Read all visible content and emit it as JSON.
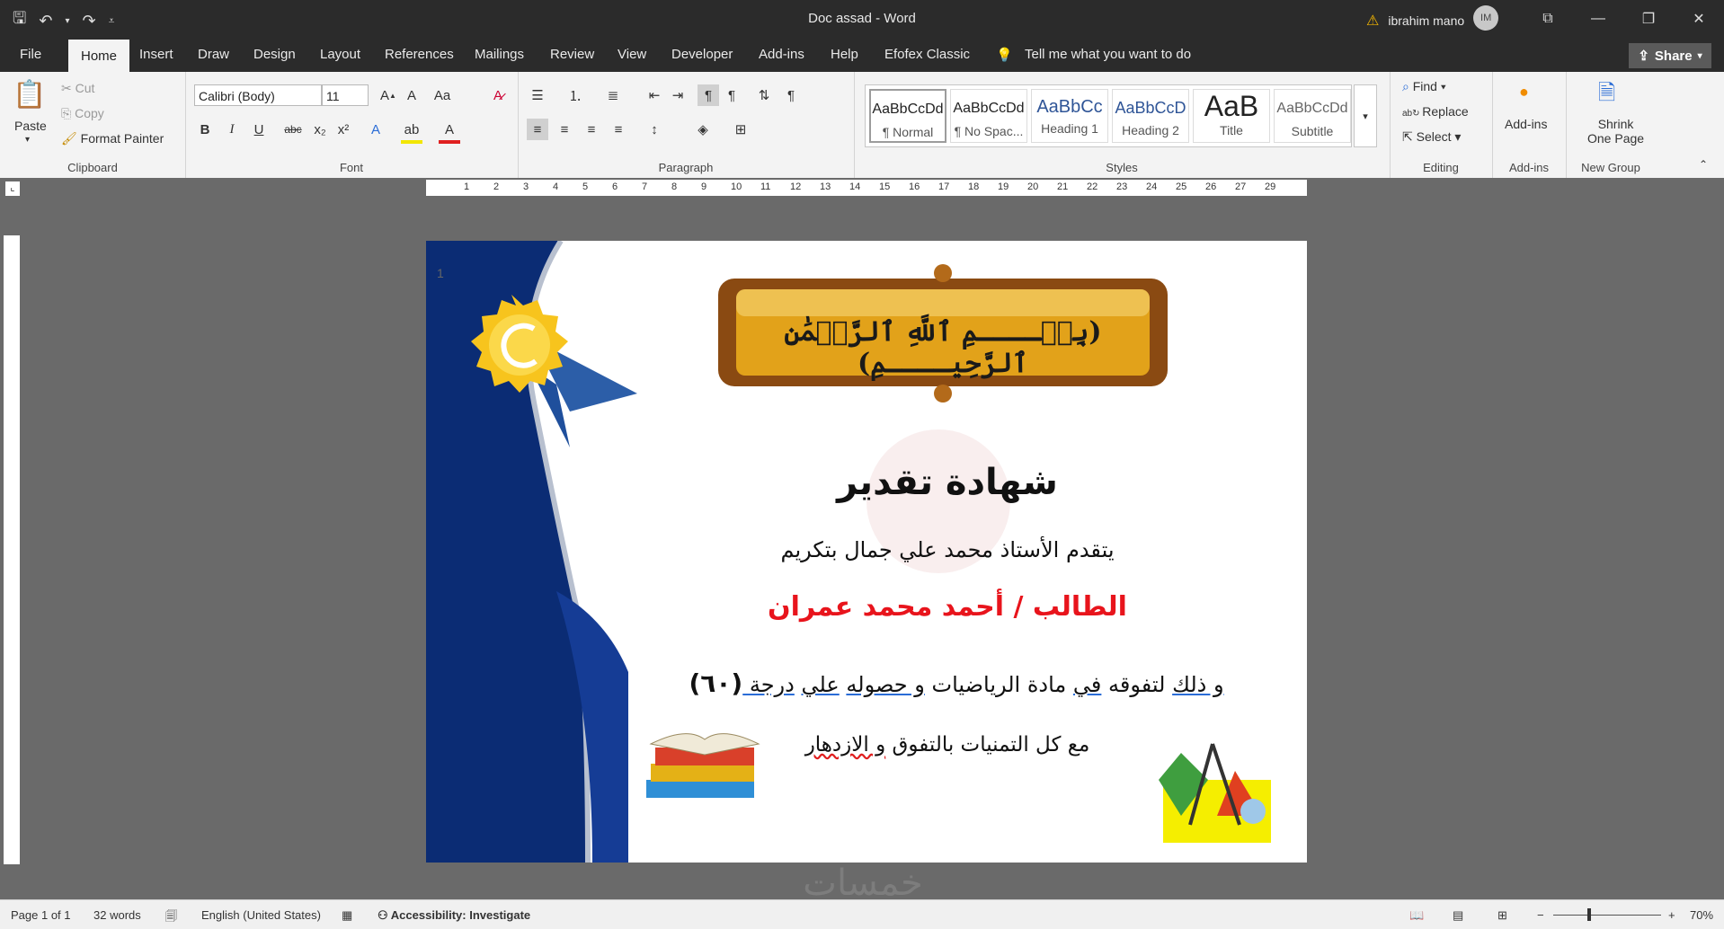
{
  "window": {
    "title": "Doc assad  -  Word",
    "user_name": "ibrahim mano",
    "user_initials": "IM"
  },
  "tabs": [
    {
      "label": "File"
    },
    {
      "label": "Home"
    },
    {
      "label": "Insert"
    },
    {
      "label": "Draw"
    },
    {
      "label": "Design"
    },
    {
      "label": "Layout"
    },
    {
      "label": "References"
    },
    {
      "label": "Mailings"
    },
    {
      "label": "Review"
    },
    {
      "label": "View"
    },
    {
      "label": "Developer"
    },
    {
      "label": "Add-ins"
    },
    {
      "label": "Help"
    },
    {
      "label": "Efofex Classic"
    }
  ],
  "tell_me": "Tell me what you want to do",
  "share_label": "Share",
  "clipboard": {
    "paste": "Paste",
    "cut": "Cut",
    "copy": "Copy",
    "format_painter": "Format Painter",
    "label": "Clipboard"
  },
  "font": {
    "family": "Calibri (Body)",
    "size": "11",
    "label": "Font",
    "case_btn": "Aa",
    "bold": "B",
    "italic": "I",
    "underline": "U",
    "strike": "abc",
    "subscript": "x₂",
    "superscript": "x²"
  },
  "paragraph": {
    "label": "Paragraph"
  },
  "styles": {
    "label": "Styles",
    "items": [
      {
        "sample": "AaBbCcDd",
        "name": "¶ Normal"
      },
      {
        "sample": "AaBbCcDd",
        "name": "¶ No Spac..."
      },
      {
        "sample": "AaBbCc",
        "name": "Heading 1"
      },
      {
        "sample": "AaBbCcD",
        "name": "Heading 2"
      },
      {
        "sample": "AaB",
        "name": "Title"
      },
      {
        "sample": "AaBbCcDd",
        "name": "Subtitle"
      }
    ]
  },
  "editing": {
    "find": "Find",
    "replace": "Replace",
    "select": "Select",
    "label": "Editing"
  },
  "addins": {
    "button": "Add-ins",
    "label": "Add-ins"
  },
  "newgroup": {
    "shrink1": "Shrink",
    "shrink2": "One Page",
    "label": "New Group"
  },
  "ruler_numbers": [
    "1",
    "2",
    "3",
    "4",
    "5",
    "6",
    "7",
    "8",
    "9",
    "10",
    "11",
    "12",
    "13",
    "14",
    "15",
    "16",
    "17",
    "18",
    "19",
    "20",
    "21",
    "22",
    "23",
    "24",
    "25",
    "26",
    "27",
    "29"
  ],
  "document": {
    "page_number_marker": "1",
    "basmala": "(بِسۡــــمِ ٱللَّهِ ٱلرَّحۡمَٰنِ ٱلرَّحِيــــمِ)",
    "title": "شهادة تقدير",
    "line1": "يتقدم الأستاذ محمد علي جمال بتكريم",
    "student": "الطالب / أحمد محمد عمران",
    "line3_a": "و ذلك",
    "line3_b": " لتفوقه ",
    "line3_c": "في",
    "line3_d": " مادة الرياضيات ",
    "line3_e": "و حصوله",
    "line3_f": " ",
    "line3_g": "علي",
    "line3_h": " ",
    "line3_i": "درجة ",
    "grade": "(٦٠)",
    "line4_a": "مع كل التمنيات بالتفوق ",
    "line4_b": "و الازدهار",
    "watermark": "خمسات"
  },
  "status": {
    "page": "Page 1 of 1",
    "words": "32 words",
    "language": "English (United States)",
    "accessibility": "Accessibility: Investigate",
    "zoom": "70%"
  },
  "colors": {
    "red_text": "#e8141c",
    "navy": "#0b2c74",
    "gold": "#e2a21a"
  }
}
